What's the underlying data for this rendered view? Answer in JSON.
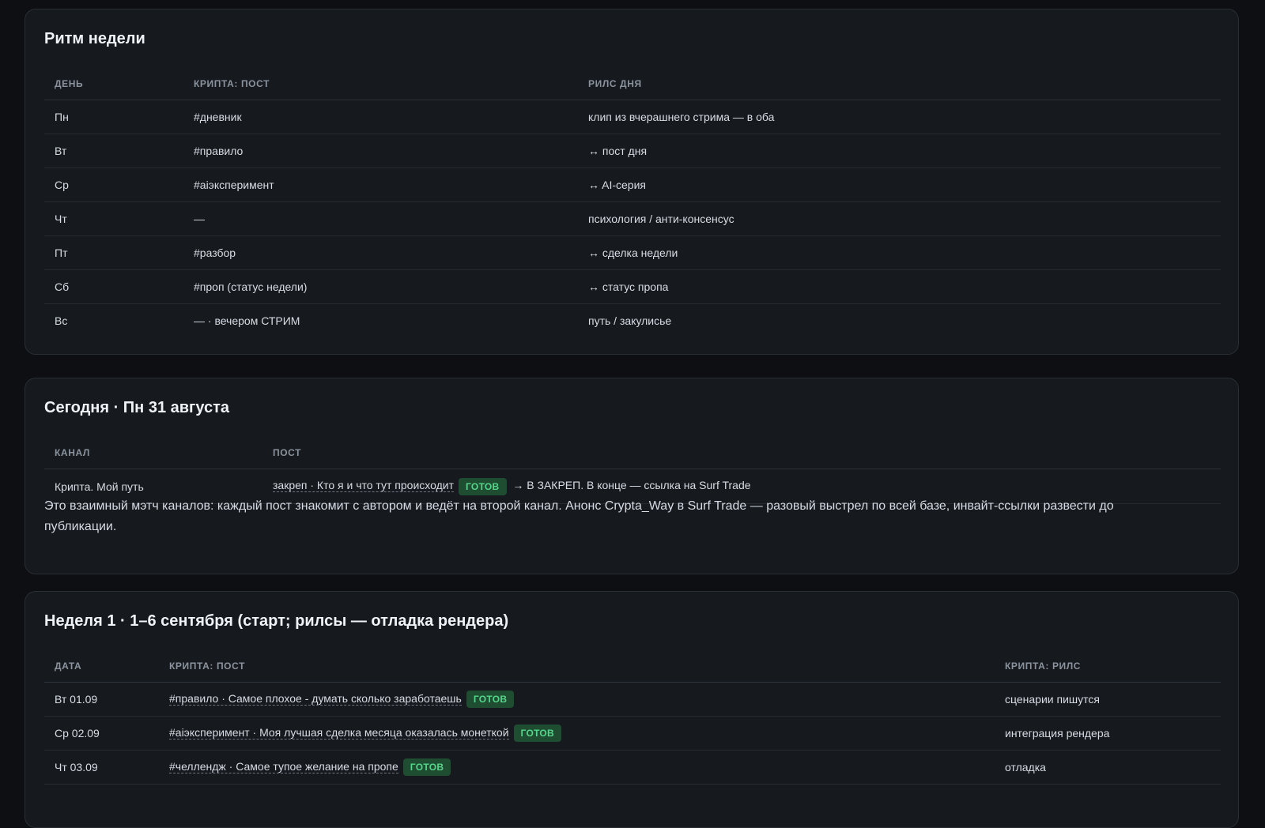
{
  "rhythm": {
    "title": "Ритм недели",
    "headers": [
      "ДЕНЬ",
      "КРИПТА: ПОСТ",
      "РИЛС ДНЯ"
    ],
    "rows": [
      [
        "Пн",
        "#дневник",
        "клип из вчерашнего стрима — в оба"
      ],
      [
        "Вт",
        "#правило",
        "↔ пост дня"
      ],
      [
        "Ср",
        "#aiэксперимент",
        "↔ AI-серия"
      ],
      [
        "Чт",
        "—",
        "психология / анти-консенсус"
      ],
      [
        "Пт",
        "#разбор",
        "↔ сделка недели"
      ],
      [
        "Сб",
        "#проп (статус недели)",
        "↔ статус пропа"
      ],
      [
        "Вс",
        "— · вечером СТРИМ",
        "путь / закулисье"
      ]
    ]
  },
  "today": {
    "title": "Сегодня · Пн 31 августа",
    "headers": [
      "КАНАЛ",
      "ПОСТ"
    ],
    "row": {
      "channel": "Крипта. Мой путь",
      "post": "закреп · Кто я и что тут происходит",
      "badge": "ГОТОВ",
      "after": "→ В ЗАКРЕП. В конце — ссылка на Surf Trade"
    },
    "note": "Это взаимный мэтч каналов: каждый пост знакомит с автором и ведёт на второй канал. Анонс Crypta_Way в Surf Trade — разовый выстрел по всей базе, инвайт-ссылки развести до публикации."
  },
  "week1": {
    "title": "Неделя 1 · 1–6 сентября (старт; рилсы — отладка рендера)",
    "headers": [
      "ДАТА",
      "КРИПТА: ПОСТ",
      "КРИПТА: РИЛС"
    ],
    "rows": [
      {
        "date": "Вт 01.09",
        "post": "#правило · Самое плохое - думать сколько заработаешь",
        "badge": "ГОТОВ",
        "reels": "сценарии пишутся"
      },
      {
        "date": "Ср 02.09",
        "post": "#aiэксперимент · Моя лучшая сделка месяца оказалась монеткой",
        "badge": "ГОТОВ",
        "reels": "интеграция рендера"
      },
      {
        "date": "Чт 03.09",
        "post": "#челлендж · Самое тупое желание на пропе",
        "badge": "ГОТОВ",
        "reels": "отладка"
      }
    ]
  }
}
